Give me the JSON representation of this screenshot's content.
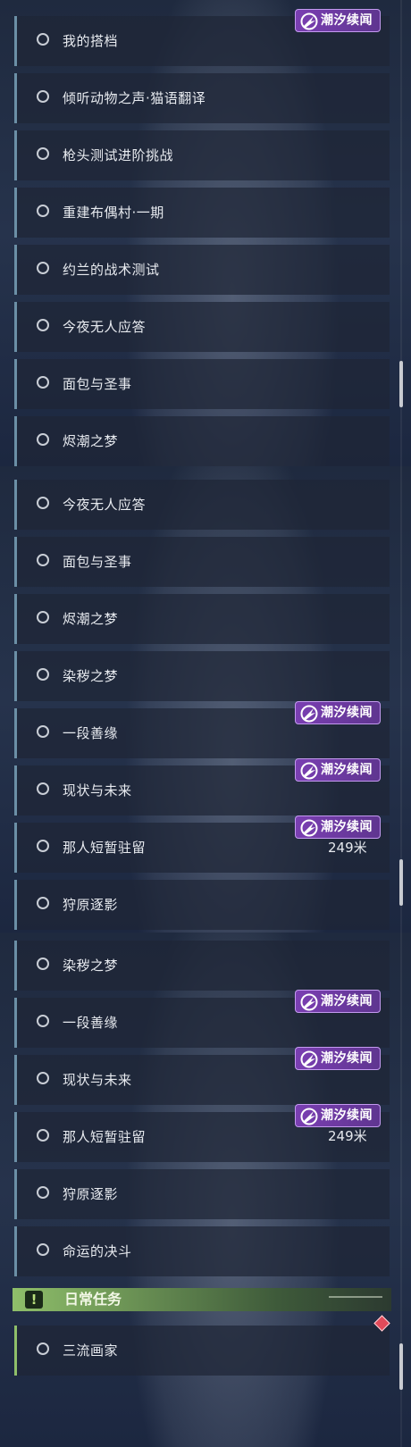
{
  "badge_label": "潮汐续闻",
  "panel1": {
    "items": [
      "我的搭档",
      "倾听动物之声·猫语翻译",
      "枪头测试进阶挑战",
      "重建布偶村·一期",
      "约兰的战术测试",
      "今夜无人应答",
      "面包与圣事",
      "烬潮之梦"
    ]
  },
  "panel2": {
    "items": [
      "今夜无人应答",
      "面包与圣事",
      "烬潮之梦",
      "染秽之梦",
      "一段善缘",
      "现状与未来",
      "那人短暂驻留",
      "狩原逐影"
    ],
    "distance": "249米"
  },
  "panel3": {
    "items": [
      "染秽之梦",
      "一段善缘",
      "现状与未来",
      "那人短暂驻留",
      "狩原逐影",
      "命运的决斗"
    ],
    "distance": "249米",
    "section_title": "日常任务",
    "daily_items": [
      "三流画家"
    ]
  },
  "colors": {
    "badge_purple": "#7a3fb2",
    "row_accent": "#6b8fa6",
    "daily_green": "#8fbf6a",
    "marker_red": "#e24b5a"
  },
  "icons": {
    "badge": "tide-emblem-icon",
    "section": "exclamation-icon",
    "marker": "diamond-marker-icon",
    "row": "circle-icon"
  }
}
